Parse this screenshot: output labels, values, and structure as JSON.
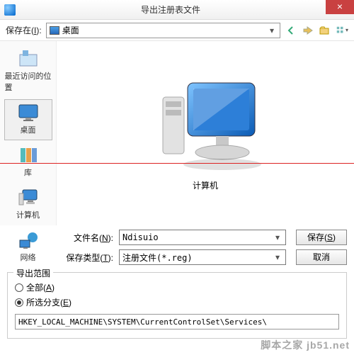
{
  "titlebar": {
    "title": "导出注册表文件",
    "close": "×"
  },
  "savein": {
    "label": "保存在(",
    "letter": "I",
    "label2": "):",
    "value": "桌面"
  },
  "toolbar_icons": [
    "back-icon",
    "up-icon",
    "new-folder-icon",
    "views-icon"
  ],
  "sidebar": {
    "items": [
      {
        "id": "recent",
        "label": "最近访问的位置"
      },
      {
        "id": "desktop",
        "label": "桌面"
      },
      {
        "id": "libraries",
        "label": "库"
      },
      {
        "id": "computer",
        "label": "计算机"
      },
      {
        "id": "network",
        "label": "网络"
      }
    ],
    "selected": "desktop"
  },
  "main": {
    "item_label": "计算机"
  },
  "filename": {
    "label": "文件名(",
    "letter": "N",
    "label2": "):",
    "value": "Ndisuio"
  },
  "filetype": {
    "label": "保存类型(",
    "letter": "T",
    "label2": "):",
    "value": "注册文件(*.reg)"
  },
  "buttons": {
    "save": "保存(",
    "save_l": "S",
    "save2": ")",
    "cancel": "取消"
  },
  "range": {
    "legend": "导出范围",
    "all": "全部(",
    "all_l": "A",
    "all2": ")",
    "branch": "所选分支(",
    "branch_l": "E",
    "branch2": ")",
    "selected": "branch",
    "path": "HKEY_LOCAL_MACHINE\\SYSTEM\\CurrentControlSet\\Services\\"
  },
  "watermark": "脚本之家 jb51.net"
}
